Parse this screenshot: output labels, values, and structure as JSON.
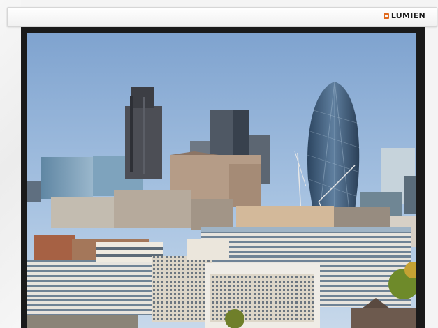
{
  "brand": {
    "name": "LUMIEN",
    "accent_color": "#e06a1f",
    "icon": "square-outline-icon"
  },
  "screen": {
    "image_subject": "city-skyline-photo"
  }
}
